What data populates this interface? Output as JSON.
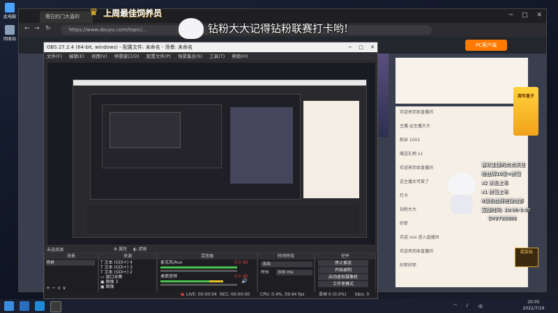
{
  "desktop": {
    "icons": [
      {
        "label": "此电脑",
        "icon": "computer-icon"
      },
      {
        "label": "回收站",
        "icon": "recycle-bin-icon"
      }
    ]
  },
  "browser": {
    "tab_title": "斋日约门大直的",
    "url": "https://www.douyu.com/topic/...",
    "page_chat": [
      "欢迎来到本直播间",
      "主播 @主播大大",
      "粉丝 1001",
      "赠送礼物 x1",
      "欢迎来到本直播间",
      "这主播太可爱了",
      "打卡",
      "钻粉大大",
      "好耶",
      "欢迎 xxx 进入直播间",
      "欢迎来到本直播间",
      "好耶好耶"
    ],
    "page_button": "PC客户端"
  },
  "obs": {
    "title": "OBS 27.2.4 (64-bit, windows) - 配置文件: 未命名 - 场景: 未命名",
    "menu": [
      "文件(F)",
      "编辑(E)",
      "视图(V)",
      "停靠窗口(D)",
      "配置文件(P)",
      "场景集合(S)",
      "工具(T)",
      "帮助(H)"
    ],
    "source_none": "未选择源",
    "props_btn": "属性",
    "filters_btn": "滤镜",
    "docks": {
      "scenes": {
        "title": "场景",
        "items": [
          "场景"
        ]
      },
      "sources": {
        "title": "来源",
        "items": [
          "文本 (GDI+) 4",
          "文本 (GDI+) 3",
          "文本 (GDI+) 2",
          "窗口采集",
          "图像 3",
          "图像"
        ]
      },
      "mixer": {
        "title": "混音器",
        "tracks": [
          "麦克风/Aux",
          "桌面音频"
        ],
        "level_label": "0.0 dB"
      },
      "transitions": {
        "title": "转场特效",
        "type": "淡出",
        "duration_label": "时长",
        "duration": "300 ms"
      },
      "controls": {
        "title": "控件",
        "buttons": [
          "停止推流",
          "开始录制",
          "启动虚拟摄像机",
          "工作室模式",
          "设置",
          "退出"
        ]
      }
    },
    "status": {
      "live": "LIVE: 00:00:04",
      "rec": "REC: 00:00:00",
      "cpu": "CPU: 0.4%, 59.94 fps",
      "dropped": "丢帧 0 (0.0%)",
      "kbs": "kb/s: 0"
    }
  },
  "overlay": {
    "top_title": "上周最佳饲养员",
    "caption": "钻粉大大记得钻粉联赛打卡哟!",
    "info_lines": [
      "喜欢主播的点点关注",
      "粉丝牌10级=房管",
      "x2 水友上车",
      "x1 房管上车",
      "8级粉丝牌进微信群",
      "直播时间: 19:00-5:00",
      "DY9793886"
    ],
    "badge_text": "超会玩",
    "promo": "周年盒子"
  },
  "taskbar": {
    "time": "20:05",
    "date": "2022/7/19",
    "lang": "中"
  },
  "colors": {
    "accent": "#ff7a00",
    "gold": "#ffc628",
    "obs_red": "#d83a3a",
    "meter_green": "#47c24e"
  }
}
